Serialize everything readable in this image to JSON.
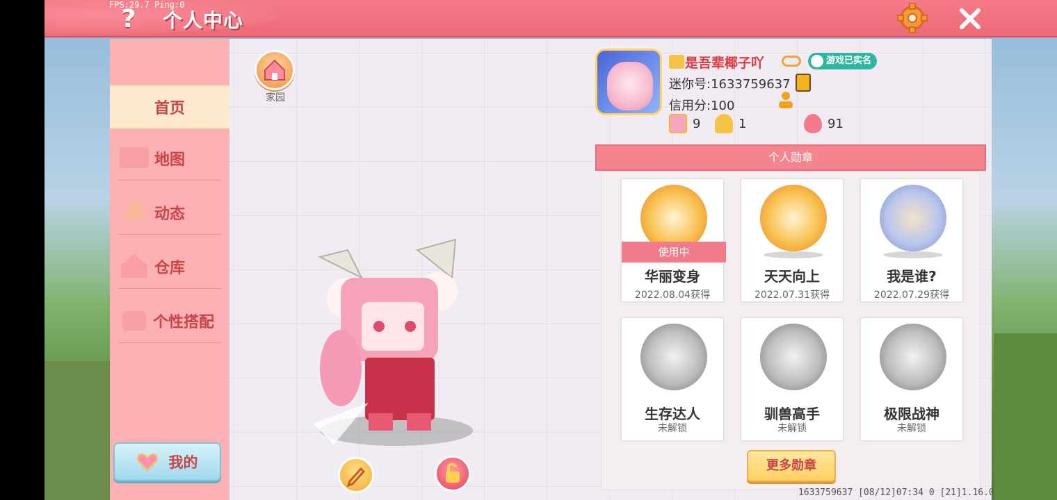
{
  "header": {
    "title": "个人中心",
    "fps": "FPS:29.7  Ping:0",
    "help_symbol": "?",
    "close_symbol": "✕"
  },
  "sidebar": {
    "items": [
      {
        "label": "首页",
        "active": true
      },
      {
        "label": "地图"
      },
      {
        "label": "动态"
      },
      {
        "label": "仓库"
      },
      {
        "label": "个性搭配"
      }
    ],
    "mine_label": "我的"
  },
  "main": {
    "home_label": "家园"
  },
  "profile": {
    "username": "是吾辈椰子吖",
    "verified_label": "游戏已实名",
    "mini_id": "迷你号:1633759637",
    "credit": "信用分:100",
    "stats": [
      {
        "icon": "plus-card-icon",
        "value": "9"
      },
      {
        "icon": "cheer-icon",
        "value": "1"
      },
      {
        "icon": "flame-icon",
        "value": "91"
      }
    ]
  },
  "badges": {
    "header": "个人勋章",
    "in_use_label": "使用中",
    "items": [
      {
        "name": "华丽变身",
        "sub": "2022.08.04获得",
        "unlocked": true,
        "in_use": true,
        "color": "#f4a23a"
      },
      {
        "name": "天天向上",
        "sub": "2022.07.31获得",
        "unlocked": true,
        "in_use": false,
        "color": "#f4a23a"
      },
      {
        "name": "我是谁?",
        "sub": "2022.07.29获得",
        "unlocked": true,
        "in_use": false,
        "color": "#8a9bd6"
      },
      {
        "name": "生存达人",
        "sub": "未解锁",
        "unlocked": false,
        "color": "#9a9a9a"
      },
      {
        "name": "驯兽高手",
        "sub": "未解锁",
        "unlocked": false,
        "color": "#9a9a9a"
      },
      {
        "name": "极限战神",
        "sub": "未解锁",
        "unlocked": false,
        "color": "#9a9a9a"
      }
    ],
    "more_label": "更多勋章"
  },
  "footer": {
    "info": "1633759637  [08/12]07:34 0  [21]1.16.0"
  },
  "colors": {
    "accent": "#ee6a78",
    "sidebar": "#fbb1b3",
    "text_red": "#c8464a"
  }
}
